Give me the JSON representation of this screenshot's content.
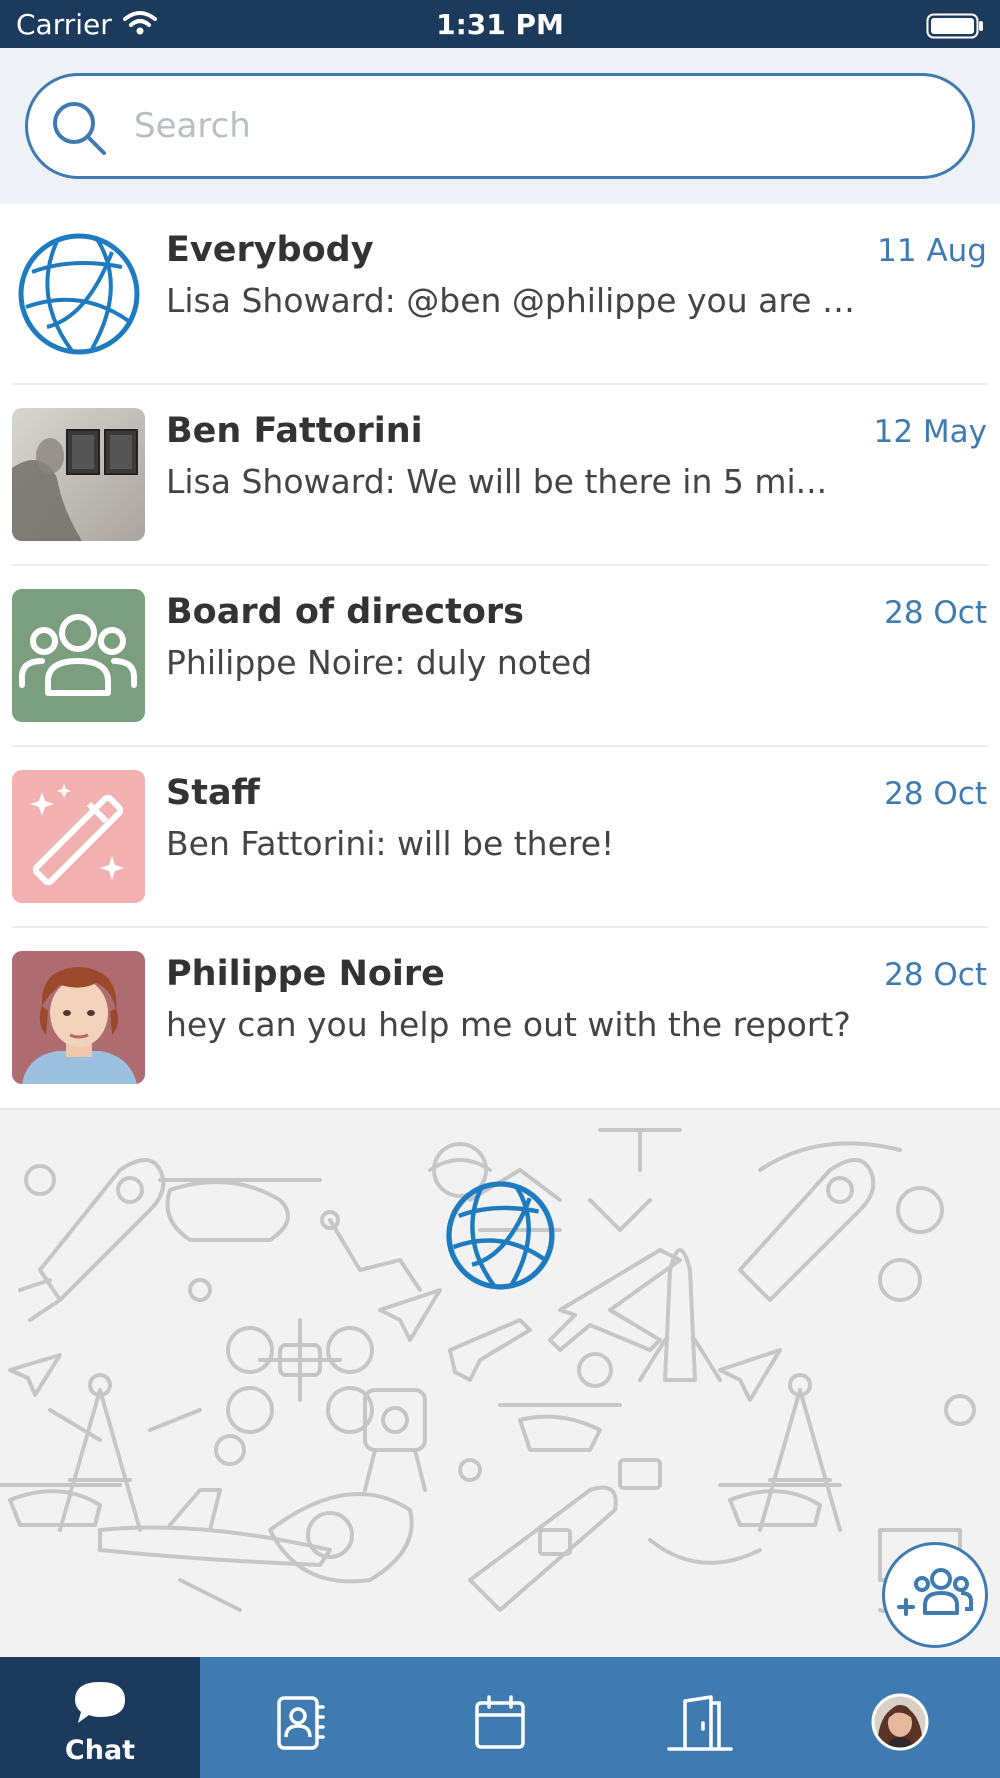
{
  "status_bar": {
    "carrier": "Carrier",
    "time": "1:31 PM"
  },
  "search": {
    "placeholder": "Search"
  },
  "chats": [
    {
      "name": "Everybody",
      "date": "11 Aug",
      "preview": "Lisa Showard: @ben @philippe you are g...",
      "avatar": "globe-icon"
    },
    {
      "name": "Ben Fattorini",
      "date": "12 May",
      "preview": "Lisa Showard: We will be there in 5 mi...",
      "avatar": "photo"
    },
    {
      "name": "Board of directors",
      "date": "28 Oct",
      "preview": "Philippe Noire: duly noted",
      "avatar": "group-icon",
      "avatar_color": "#7a9e7e"
    },
    {
      "name": "Staff",
      "date": "28 Oct",
      "preview": "Ben Fattorini: will be there!",
      "avatar": "magic-wand-icon",
      "avatar_color": "#f2b0b0"
    },
    {
      "name": "Philippe Noire",
      "date": "28 Oct",
      "preview": "hey can you help me out with the report?",
      "avatar": "photo"
    }
  ],
  "tab_bar": {
    "tabs": [
      {
        "label": "Chat",
        "icon": "chat-bubble-icon",
        "active": true
      },
      {
        "label": "",
        "icon": "contacts-icon"
      },
      {
        "label": "",
        "icon": "calendar-icon"
      },
      {
        "label": "",
        "icon": "door-icon"
      },
      {
        "label": "",
        "icon": "profile-avatar"
      }
    ]
  },
  "colors": {
    "brand_blue": "#3f7bb0",
    "dark_navy": "#1c3a5c",
    "date_blue": "#3f7bb0"
  }
}
